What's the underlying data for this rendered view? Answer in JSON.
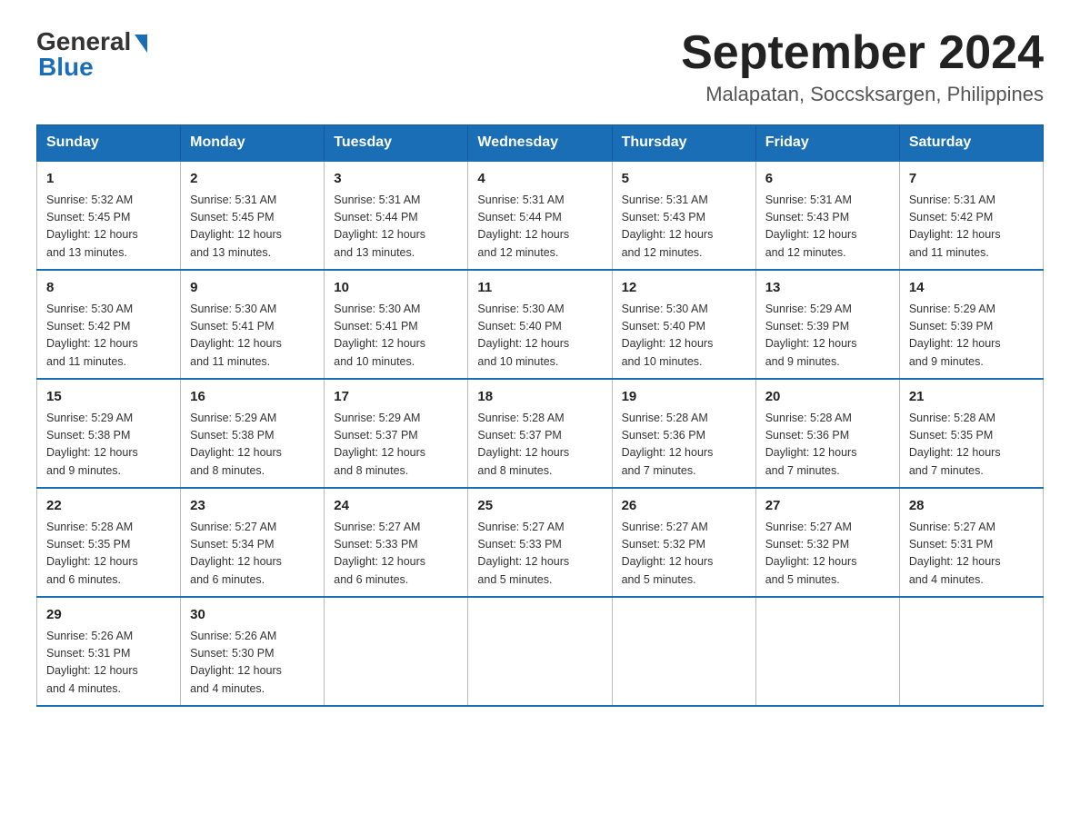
{
  "header": {
    "logo_general": "General",
    "logo_blue": "Blue",
    "month_year": "September 2024",
    "location": "Malapatan, Soccsksargen, Philippines"
  },
  "days_of_week": [
    "Sunday",
    "Monday",
    "Tuesday",
    "Wednesday",
    "Thursday",
    "Friday",
    "Saturday"
  ],
  "weeks": [
    [
      {
        "day": "1",
        "sunrise": "5:32 AM",
        "sunset": "5:45 PM",
        "daylight": "12 hours and 13 minutes."
      },
      {
        "day": "2",
        "sunrise": "5:31 AM",
        "sunset": "5:45 PM",
        "daylight": "12 hours and 13 minutes."
      },
      {
        "day": "3",
        "sunrise": "5:31 AM",
        "sunset": "5:44 PM",
        "daylight": "12 hours and 13 minutes."
      },
      {
        "day": "4",
        "sunrise": "5:31 AM",
        "sunset": "5:44 PM",
        "daylight": "12 hours and 12 minutes."
      },
      {
        "day": "5",
        "sunrise": "5:31 AM",
        "sunset": "5:43 PM",
        "daylight": "12 hours and 12 minutes."
      },
      {
        "day": "6",
        "sunrise": "5:31 AM",
        "sunset": "5:43 PM",
        "daylight": "12 hours and 12 minutes."
      },
      {
        "day": "7",
        "sunrise": "5:31 AM",
        "sunset": "5:42 PM",
        "daylight": "12 hours and 11 minutes."
      }
    ],
    [
      {
        "day": "8",
        "sunrise": "5:30 AM",
        "sunset": "5:42 PM",
        "daylight": "12 hours and 11 minutes."
      },
      {
        "day": "9",
        "sunrise": "5:30 AM",
        "sunset": "5:41 PM",
        "daylight": "12 hours and 11 minutes."
      },
      {
        "day": "10",
        "sunrise": "5:30 AM",
        "sunset": "5:41 PM",
        "daylight": "12 hours and 10 minutes."
      },
      {
        "day": "11",
        "sunrise": "5:30 AM",
        "sunset": "5:40 PM",
        "daylight": "12 hours and 10 minutes."
      },
      {
        "day": "12",
        "sunrise": "5:30 AM",
        "sunset": "5:40 PM",
        "daylight": "12 hours and 10 minutes."
      },
      {
        "day": "13",
        "sunrise": "5:29 AM",
        "sunset": "5:39 PM",
        "daylight": "12 hours and 9 minutes."
      },
      {
        "day": "14",
        "sunrise": "5:29 AM",
        "sunset": "5:39 PM",
        "daylight": "12 hours and 9 minutes."
      }
    ],
    [
      {
        "day": "15",
        "sunrise": "5:29 AM",
        "sunset": "5:38 PM",
        "daylight": "12 hours and 9 minutes."
      },
      {
        "day": "16",
        "sunrise": "5:29 AM",
        "sunset": "5:38 PM",
        "daylight": "12 hours and 8 minutes."
      },
      {
        "day": "17",
        "sunrise": "5:29 AM",
        "sunset": "5:37 PM",
        "daylight": "12 hours and 8 minutes."
      },
      {
        "day": "18",
        "sunrise": "5:28 AM",
        "sunset": "5:37 PM",
        "daylight": "12 hours and 8 minutes."
      },
      {
        "day": "19",
        "sunrise": "5:28 AM",
        "sunset": "5:36 PM",
        "daylight": "12 hours and 7 minutes."
      },
      {
        "day": "20",
        "sunrise": "5:28 AM",
        "sunset": "5:36 PM",
        "daylight": "12 hours and 7 minutes."
      },
      {
        "day": "21",
        "sunrise": "5:28 AM",
        "sunset": "5:35 PM",
        "daylight": "12 hours and 7 minutes."
      }
    ],
    [
      {
        "day": "22",
        "sunrise": "5:28 AM",
        "sunset": "5:35 PM",
        "daylight": "12 hours and 6 minutes."
      },
      {
        "day": "23",
        "sunrise": "5:27 AM",
        "sunset": "5:34 PM",
        "daylight": "12 hours and 6 minutes."
      },
      {
        "day": "24",
        "sunrise": "5:27 AM",
        "sunset": "5:33 PM",
        "daylight": "12 hours and 6 minutes."
      },
      {
        "day": "25",
        "sunrise": "5:27 AM",
        "sunset": "5:33 PM",
        "daylight": "12 hours and 5 minutes."
      },
      {
        "day": "26",
        "sunrise": "5:27 AM",
        "sunset": "5:32 PM",
        "daylight": "12 hours and 5 minutes."
      },
      {
        "day": "27",
        "sunrise": "5:27 AM",
        "sunset": "5:32 PM",
        "daylight": "12 hours and 5 minutes."
      },
      {
        "day": "28",
        "sunrise": "5:27 AM",
        "sunset": "5:31 PM",
        "daylight": "12 hours and 4 minutes."
      }
    ],
    [
      {
        "day": "29",
        "sunrise": "5:26 AM",
        "sunset": "5:31 PM",
        "daylight": "12 hours and 4 minutes."
      },
      {
        "day": "30",
        "sunrise": "5:26 AM",
        "sunset": "5:30 PM",
        "daylight": "12 hours and 4 minutes."
      },
      null,
      null,
      null,
      null,
      null
    ]
  ],
  "labels": {
    "sunrise_prefix": "Sunrise: ",
    "sunset_prefix": "Sunset: ",
    "daylight_prefix": "Daylight: "
  }
}
